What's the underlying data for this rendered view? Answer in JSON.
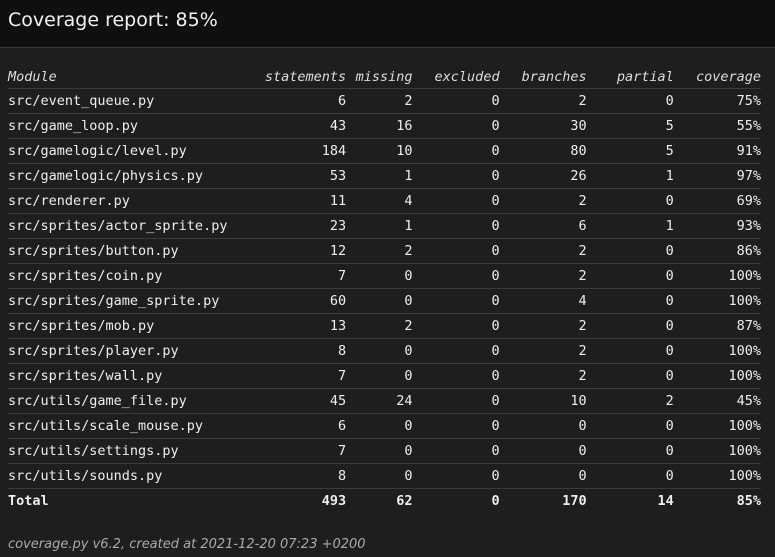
{
  "header": {
    "title": "Coverage report: 85%"
  },
  "table": {
    "columns": {
      "module": "Module",
      "statements": "statements",
      "missing": "missing",
      "excluded": "excluded",
      "branches": "branches",
      "partial": "partial",
      "coverage": "coverage"
    },
    "rows": [
      {
        "module": "src/event_queue.py",
        "statements": "6",
        "missing": "2",
        "excluded": "0",
        "branches": "2",
        "partial": "0",
        "coverage": "75%"
      },
      {
        "module": "src/game_loop.py",
        "statements": "43",
        "missing": "16",
        "excluded": "0",
        "branches": "30",
        "partial": "5",
        "coverage": "55%"
      },
      {
        "module": "src/gamelogic/level.py",
        "statements": "184",
        "missing": "10",
        "excluded": "0",
        "branches": "80",
        "partial": "5",
        "coverage": "91%"
      },
      {
        "module": "src/gamelogic/physics.py",
        "statements": "53",
        "missing": "1",
        "excluded": "0",
        "branches": "26",
        "partial": "1",
        "coverage": "97%"
      },
      {
        "module": "src/renderer.py",
        "statements": "11",
        "missing": "4",
        "excluded": "0",
        "branches": "2",
        "partial": "0",
        "coverage": "69%"
      },
      {
        "module": "src/sprites/actor_sprite.py",
        "statements": "23",
        "missing": "1",
        "excluded": "0",
        "branches": "6",
        "partial": "1",
        "coverage": "93%"
      },
      {
        "module": "src/sprites/button.py",
        "statements": "12",
        "missing": "2",
        "excluded": "0",
        "branches": "2",
        "partial": "0",
        "coverage": "86%"
      },
      {
        "module": "src/sprites/coin.py",
        "statements": "7",
        "missing": "0",
        "excluded": "0",
        "branches": "2",
        "partial": "0",
        "coverage": "100%"
      },
      {
        "module": "src/sprites/game_sprite.py",
        "statements": "60",
        "missing": "0",
        "excluded": "0",
        "branches": "4",
        "partial": "0",
        "coverage": "100%"
      },
      {
        "module": "src/sprites/mob.py",
        "statements": "13",
        "missing": "2",
        "excluded": "0",
        "branches": "2",
        "partial": "0",
        "coverage": "87%"
      },
      {
        "module": "src/sprites/player.py",
        "statements": "8",
        "missing": "0",
        "excluded": "0",
        "branches": "2",
        "partial": "0",
        "coverage": "100%"
      },
      {
        "module": "src/sprites/wall.py",
        "statements": "7",
        "missing": "0",
        "excluded": "0",
        "branches": "2",
        "partial": "0",
        "coverage": "100%"
      },
      {
        "module": "src/utils/game_file.py",
        "statements": "45",
        "missing": "24",
        "excluded": "0",
        "branches": "10",
        "partial": "2",
        "coverage": "45%"
      },
      {
        "module": "src/utils/scale_mouse.py",
        "statements": "6",
        "missing": "0",
        "excluded": "0",
        "branches": "0",
        "partial": "0",
        "coverage": "100%"
      },
      {
        "module": "src/utils/settings.py",
        "statements": "7",
        "missing": "0",
        "excluded": "0",
        "branches": "0",
        "partial": "0",
        "coverage": "100%"
      },
      {
        "module": "src/utils/sounds.py",
        "statements": "8",
        "missing": "0",
        "excluded": "0",
        "branches": "0",
        "partial": "0",
        "coverage": "100%"
      }
    ],
    "total": {
      "module": "Total",
      "statements": "493",
      "missing": "62",
      "excluded": "0",
      "branches": "170",
      "partial": "14",
      "coverage": "85%"
    }
  },
  "footer": {
    "text": "coverage.py v6.2, created at 2021-12-20 07:23 +0200"
  }
}
